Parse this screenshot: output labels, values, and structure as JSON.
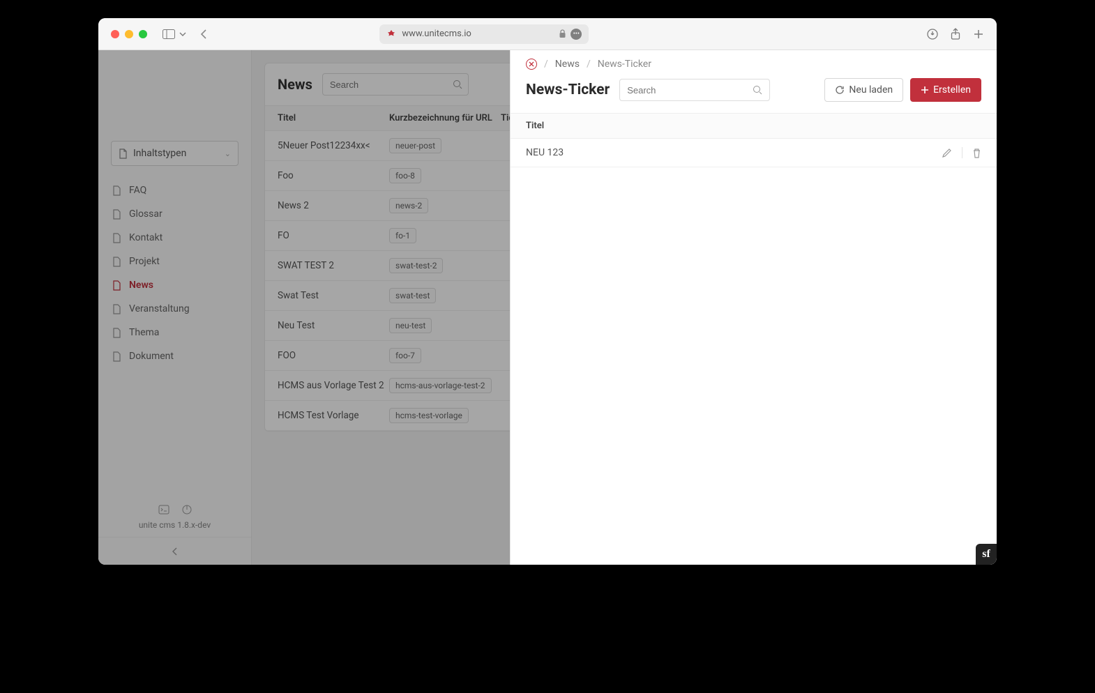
{
  "browser": {
    "url": "www.unitecms.io"
  },
  "sidebar": {
    "selector_label": "Inhaltstypen",
    "items": [
      {
        "label": "FAQ"
      },
      {
        "label": "Glossar"
      },
      {
        "label": "Kontakt"
      },
      {
        "label": "Projekt"
      },
      {
        "label": "News"
      },
      {
        "label": "Veranstaltung"
      },
      {
        "label": "Thema"
      },
      {
        "label": "Dokument"
      }
    ],
    "version": "unite cms 1.8.x-dev"
  },
  "main": {
    "title": "News",
    "search_placeholder": "Search",
    "columns": {
      "title": "Titel",
      "slug": "Kurzbezeichnung für URL",
      "tick": "Tick"
    },
    "rows": [
      {
        "title": "5Neuer Post12234xx<",
        "slug": "neuer-post"
      },
      {
        "title": "Foo",
        "slug": "foo-8"
      },
      {
        "title": "News 2",
        "slug": "news-2"
      },
      {
        "title": "FO",
        "slug": "fo-1"
      },
      {
        "title": "SWAT TEST 2",
        "slug": "swat-test-2"
      },
      {
        "title": "Swat Test",
        "slug": "swat-test"
      },
      {
        "title": "Neu Test",
        "slug": "neu-test"
      },
      {
        "title": "FOO",
        "slug": "foo-7"
      },
      {
        "title": "HCMS aus Vorlage Test 2",
        "slug": "hcms-aus-vorlage-test-2"
      },
      {
        "title": "HCMS Test Vorlage",
        "slug": "hcms-test-vorlage"
      }
    ]
  },
  "drawer": {
    "breadcrumb": {
      "root": "News",
      "current": "News-Ticker"
    },
    "title": "News-Ticker",
    "search_placeholder": "Search",
    "reload_label": "Neu laden",
    "create_label": "Erstellen",
    "column_title": "Titel",
    "rows": [
      {
        "title": "NEU 123"
      }
    ]
  }
}
